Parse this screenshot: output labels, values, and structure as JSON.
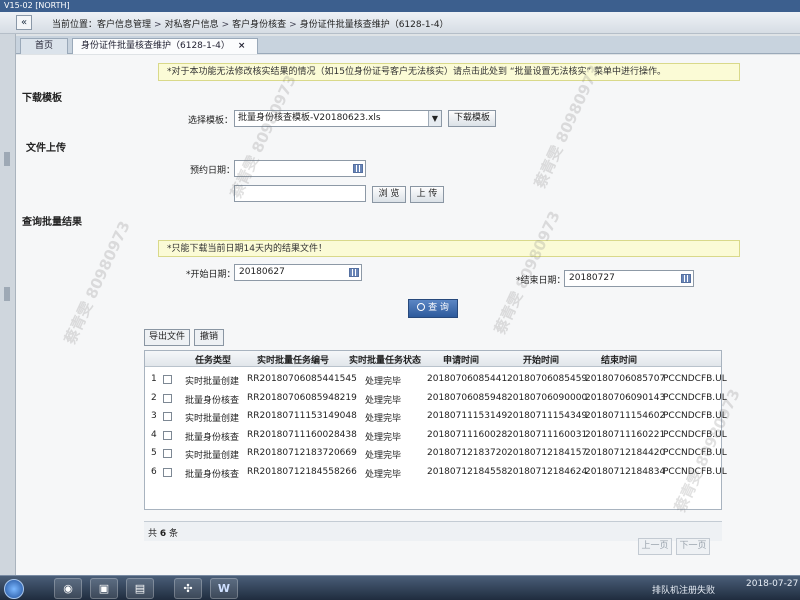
{
  "window": {
    "title": "V15-02 [NORTH]"
  },
  "breadcrumb": {
    "collapse_symbol": "«",
    "prefix": "当前位置：",
    "items": [
      "客户信息管理",
      "对私客户信息",
      "客户身份核查",
      "身份证件批量核查维护（6128-1-4）"
    ],
    "separator": ">"
  },
  "tabs": [
    {
      "label": "首页"
    },
    {
      "label": "身份证件批量核查维护（6128-1-4）",
      "close": "×"
    }
  ],
  "notice_top": "*对于本功能无法修改核实结果的情况（如15位身份证号客户无法核实）请点击此处到 “批量设置无法核实” 菜单中进行操作。",
  "download_section": {
    "title": "下载模板",
    "select_label": "选择模板：",
    "select_value": "批量身份核查模板-V20180623.xls",
    "download_button": "下载模板"
  },
  "upload_section": {
    "title": "文件上传",
    "date_label": "预约日期：",
    "date_value": "",
    "file_value": "",
    "browse_button": "浏 览",
    "upload_button": "上 传"
  },
  "query_section": {
    "title": "查询批量结果",
    "notice": "*只能下载当前日期14天内的结果文件！",
    "start_label": "*开始日期：",
    "start_value": "20180627",
    "end_label": "*结束日期：",
    "end_value": "20180727",
    "query_button": "查 询"
  },
  "toolbar": {
    "export": "导出文件",
    "revoke": "撤销"
  },
  "table": {
    "columns": [
      "任务类型",
      "实时批量任务编号",
      "实时批量任务状态",
      "申请时间",
      "开始时间",
      "结束时间"
    ],
    "rows": [
      {
        "no": "1",
        "type": "实时批量创建",
        "id": "RR20180706085441545",
        "status": "处理完毕",
        "apply": "20180706085441",
        "start": "20180706085459",
        "end": "20180706085707",
        "extra": "PCCNDCFB.UL"
      },
      {
        "no": "2",
        "type": "批量身份核查",
        "id": "RR20180706085948219",
        "status": "处理完毕",
        "apply": "20180706085948",
        "start": "20180706090000",
        "end": "20180706090143",
        "extra": "PCCNDCFB.UL"
      },
      {
        "no": "3",
        "type": "实时批量创建",
        "id": "RR20180711153149048",
        "status": "处理完毕",
        "apply": "20180711153149",
        "start": "20180711154349",
        "end": "20180711154602",
        "extra": "PCCNDCFB.UL"
      },
      {
        "no": "4",
        "type": "批量身份核查",
        "id": "RR20180711160028438",
        "status": "处理完毕",
        "apply": "20180711160028",
        "start": "20180711160031",
        "end": "20180711160221",
        "extra": "PCCNDCFB.UL"
      },
      {
        "no": "5",
        "type": "实时批量创建",
        "id": "RR20180712183720669",
        "status": "处理完毕",
        "apply": "20180712183720",
        "start": "20180712184157",
        "end": "20180712184420",
        "extra": "PCCNDCFB.UL"
      },
      {
        "no": "6",
        "type": "批量身份核查",
        "id": "RR20180712184558266",
        "status": "处理完毕",
        "apply": "20180712184558",
        "start": "20180712184624",
        "end": "20180712184834",
        "extra": "PCCNDCFB.UL"
      }
    ]
  },
  "footer": {
    "total_prefix": "共",
    "total_count": "6",
    "total_suffix": "条",
    "prev": "上一页",
    "next": "下一页"
  },
  "watermark": {
    "name": "蔡青雯",
    "number": "80980973"
  },
  "taskbar": {
    "tray_text": "排队机注册失败",
    "date": "2018-07-27"
  }
}
